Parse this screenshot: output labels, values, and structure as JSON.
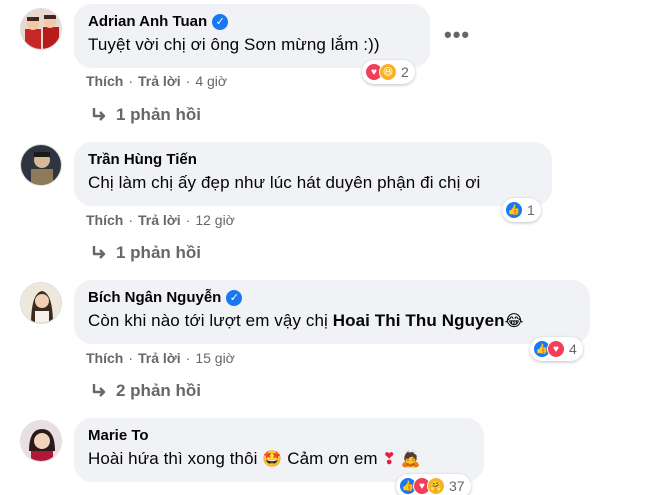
{
  "colors": {
    "accent": "#1877f2",
    "bubble": "#f0f2f5",
    "meta": "#65676b"
  },
  "comments": [
    {
      "author": "Adrian Anh Tuan",
      "verified": true,
      "text": "Tuyệt vời chị ơi ông Sơn mừng lắm :))",
      "like_label": "Thích",
      "reply_label": "Trả lời",
      "time": "4 giờ",
      "reaction_count": "2",
      "reactions": [
        "love-icon",
        "haha-icon"
      ],
      "replies_label": "1 phản hồi"
    },
    {
      "author": "Trần Hùng Tiến",
      "verified": false,
      "text": "Chị làm chị ấy đẹp như lúc hát duyên phận đi chị ơi",
      "like_label": "Thích",
      "reply_label": "Trả lời",
      "time": "12 giờ",
      "reaction_count": "1",
      "reactions": [
        "like-icon"
      ],
      "replies_label": "1 phản hồi"
    },
    {
      "author": "Bích Ngân Nguyễn",
      "verified": true,
      "text_before": "Còn khi nào tới lượt em vậy chị ",
      "mention": "Hoai Thi Thu Nguyen",
      "like_label": "Thích",
      "reply_label": "Trả lời",
      "time": "15 giờ",
      "reaction_count": "4",
      "reactions": [
        "like-icon",
        "love-icon"
      ],
      "replies_label": "2 phản hồi"
    },
    {
      "author": "Marie To",
      "verified": false,
      "text_a": "Hoài hứa thì xong thôi ",
      "text_b": " Cảm ơn em ",
      "reaction_count": "37",
      "reactions": [
        "like-icon",
        "love-icon",
        "care-icon"
      ]
    }
  ],
  "more_label": "•••"
}
